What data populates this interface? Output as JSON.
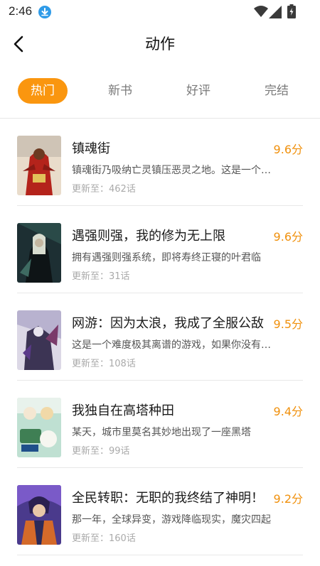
{
  "status_bar": {
    "time": "2:46",
    "icons": [
      "download-icon",
      "wifi-icon",
      "signal-icon",
      "battery-icon"
    ]
  },
  "header": {
    "title": "动作",
    "back_icon": "back-arrow-icon"
  },
  "tabs": [
    {
      "label": "热门",
      "active": true
    },
    {
      "label": "新书",
      "active": false
    },
    {
      "label": "好评",
      "active": false
    },
    {
      "label": "完结",
      "active": false
    }
  ],
  "colors": {
    "accent": "#fa960f",
    "score": "#f0900c",
    "download_icon": "#2f9be8"
  },
  "comics": [
    {
      "title": "镇魂街",
      "desc": "镇魂街乃吸纳亡灵镇压恶灵之地。这是一个人灵共存的世界",
      "update": "更新至：462话",
      "score": "9.6分"
    },
    {
      "title": "遇强则强，我的修为无上限",
      "desc": "拥有遇强则强系统，即将寿终正寝的叶君临",
      "update": "更新至：31话",
      "score": "9.6分"
    },
    {
      "title": "网游：因为太浪，我成了全服公敌",
      "desc": "这是一个难度极其离谱的游戏，如果你没有天赋",
      "update": "更新至：108话",
      "score": "9.5分"
    },
    {
      "title": "我独自在高塔种田",
      "desc": "某天，城市里莫名其妙地出现了一座黑塔",
      "update": "更新至：99话",
      "score": "9.4分"
    },
    {
      "title": "全民转职：无职的我终结了神明！",
      "desc": "那一年，全球异变，游戏降临现实，魔灾四起",
      "update": "更新至：160话",
      "score": "9.2分"
    }
  ]
}
